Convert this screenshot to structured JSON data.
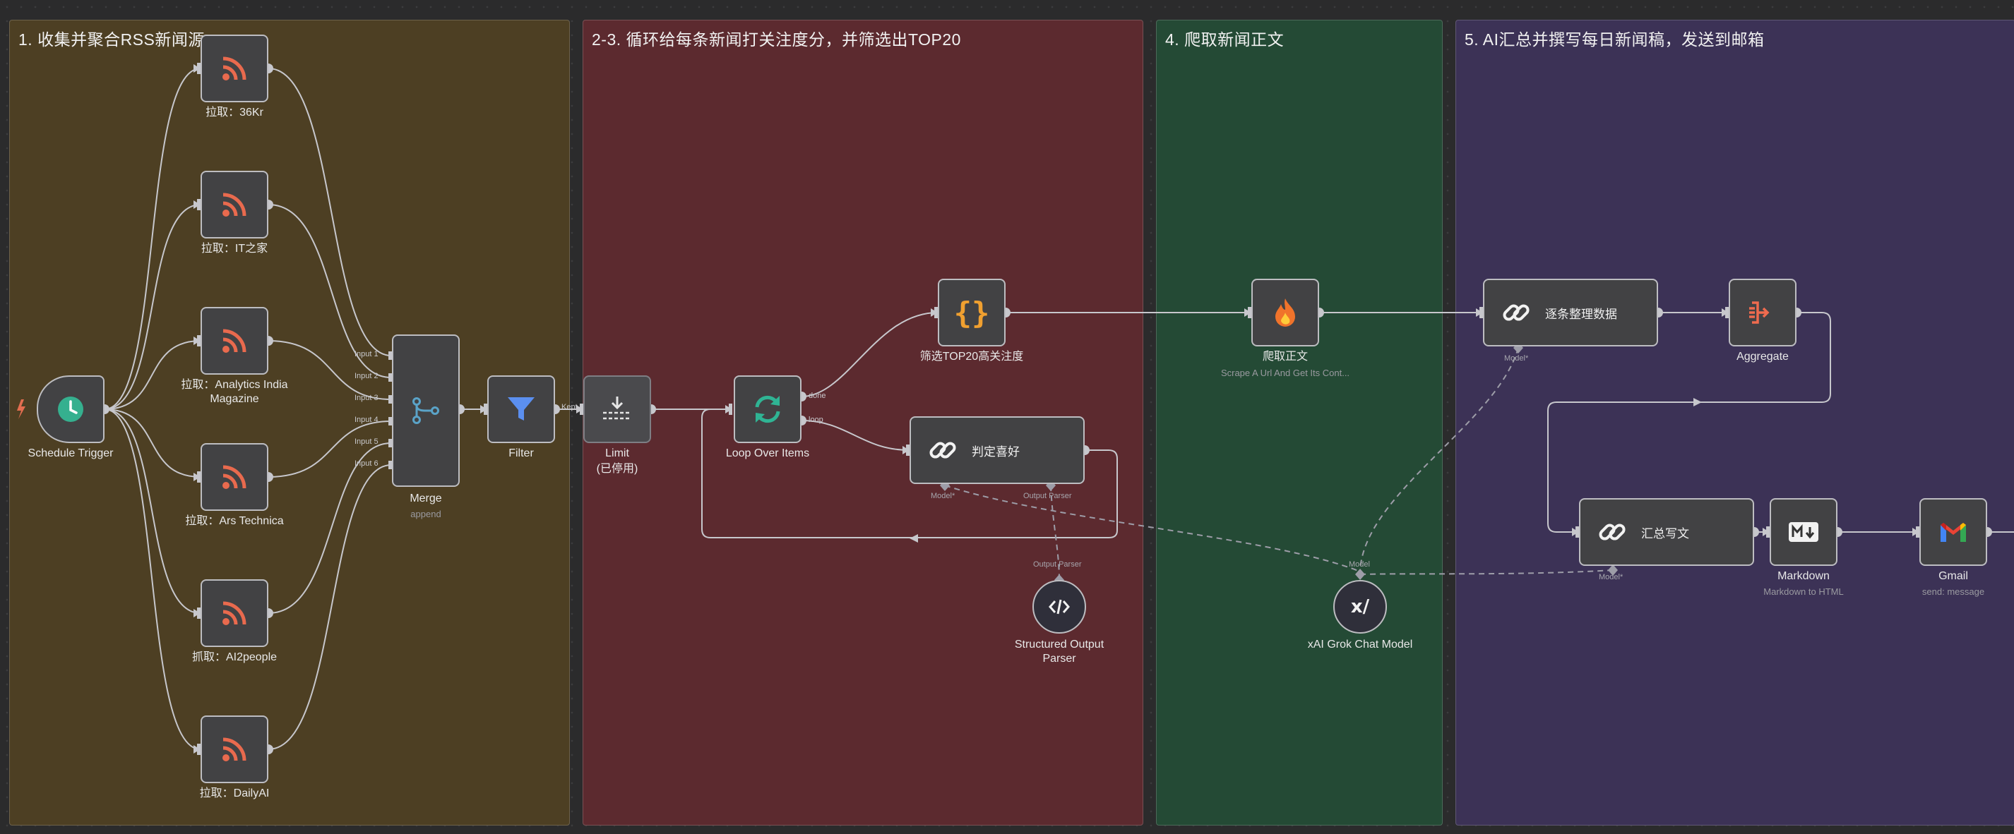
{
  "groups": [
    {
      "title": "1. 收集并聚合RSS新闻源",
      "color": "#4d3f23"
    },
    {
      "title": "2-3. 循环给每条新闻打关注度分，并筛选出TOP20",
      "color": "#5c2a2f"
    },
    {
      "title": "4. 爬取新闻正文",
      "color": "#244a35"
    },
    {
      "title": "5. AI汇总并撰写每日新闻稿，发送到邮箱",
      "color": "#3c3256"
    }
  ],
  "nodes": {
    "schedule": {
      "label": "Schedule Trigger",
      "icon": "clock-icon"
    },
    "rss1": {
      "label": "拉取：36Kr",
      "icon": "rss-icon"
    },
    "rss2": {
      "label": "拉取：IT之家",
      "icon": "rss-icon"
    },
    "rss3": {
      "label": "拉取：Analytics India",
      "label2": "Magazine",
      "icon": "rss-icon"
    },
    "rss4": {
      "label": "拉取：Ars Technica",
      "icon": "rss-icon"
    },
    "rss5": {
      "label": "抓取：AI2people",
      "icon": "rss-icon"
    },
    "rss6": {
      "label": "拉取：DailyAI",
      "icon": "rss-icon"
    },
    "merge": {
      "label": "Merge",
      "sub": "append",
      "icon": "merge-icon",
      "inputs": [
        "Input 1",
        "Input 2",
        "Input 3",
        "Input 4",
        "Input 5",
        "Input 6"
      ]
    },
    "filter": {
      "label": "Filter",
      "icon": "filter-icon",
      "out": "Kept"
    },
    "limit": {
      "label": "Limit",
      "label2": "(已停用)",
      "icon": "limit-icon"
    },
    "loop": {
      "label": "Loop Over Items",
      "icon": "loop-icon",
      "out_done": "done",
      "out_loop": "loop"
    },
    "top20": {
      "label": "筛选TOP20高关注度",
      "icon": "code-icon"
    },
    "judge": {
      "label": "判定喜好",
      "icon": "chain-link-icon",
      "port_model": "Model*",
      "port_parser": "Output Parser"
    },
    "parser": {
      "label": "Structured Output",
      "label2": "Parser",
      "icon": "code-brackets-icon",
      "port": "Output Parser"
    },
    "scrape": {
      "label": "爬取正文",
      "sub": "Scrape A Url And Get Its Cont...",
      "icon": "fire-icon"
    },
    "organize": {
      "label": "逐条整理数据",
      "icon": "chain-link-icon",
      "port_model": "Model*"
    },
    "aggregate": {
      "label": "Aggregate",
      "icon": "aggregate-icon"
    },
    "write": {
      "label": "汇总写文",
      "icon": "chain-link-icon",
      "port_model": "Model*"
    },
    "markdown": {
      "label": "Markdown",
      "sub": "Markdown to HTML",
      "icon": "markdown-icon"
    },
    "gmail": {
      "label": "Gmail",
      "sub": "send: message",
      "icon": "gmail-icon"
    },
    "xai": {
      "label": "xAI Grok Chat Model",
      "icon": "xai-icon",
      "port": "Model"
    }
  }
}
